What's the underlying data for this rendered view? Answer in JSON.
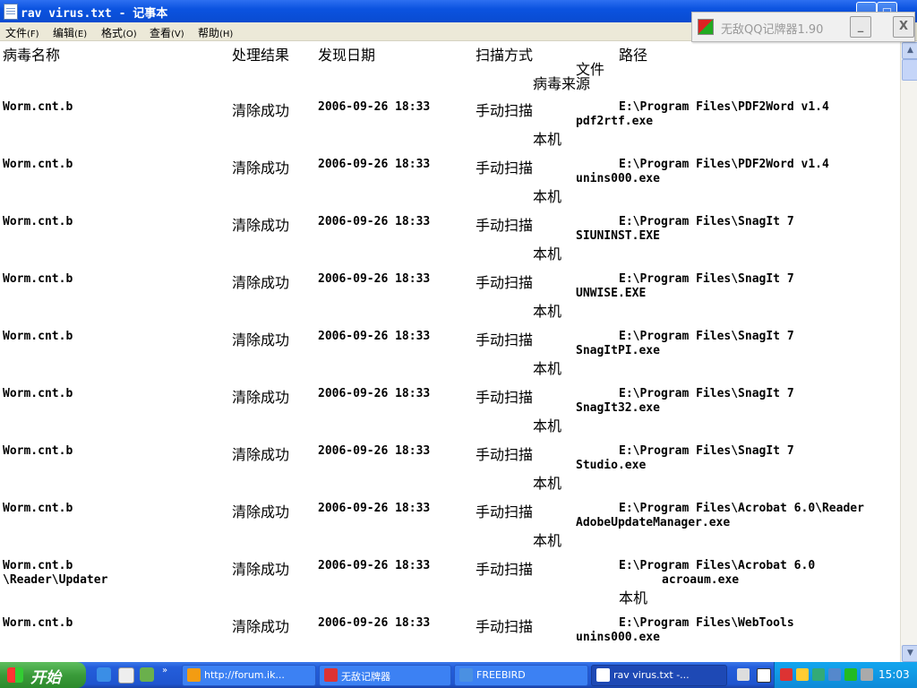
{
  "window": {
    "title": "rav virus.txt - 记事本"
  },
  "menu": [
    {
      "label": "文件",
      "accel": "(F)"
    },
    {
      "label": "编辑",
      "accel": "(E)"
    },
    {
      "label": "格式",
      "accel": "(O)"
    },
    {
      "label": "查看",
      "accel": "(V)"
    },
    {
      "label": "帮助",
      "accel": "(H)"
    }
  ],
  "qq_popup": {
    "title": "无敌QQ记牌器1.90",
    "minimize": "_",
    "close": "X"
  },
  "document": {
    "header": {
      "name": "病毒名称",
      "result": "处理结果",
      "date": "发现日期",
      "method": "扫描方式",
      "path": "路径",
      "file": "文件",
      "source": "病毒来源"
    },
    "rows": [
      {
        "name": "Worm.cnt.b",
        "result": "清除成功",
        "date": "2006-09-26 18:33",
        "method": "手动扫描",
        "path": "E:\\Program Files\\PDF2Word v1.4",
        "file": "pdf2rtf.exe",
        "source": "本机"
      },
      {
        "name": "Worm.cnt.b",
        "result": "清除成功",
        "date": "2006-09-26 18:33",
        "method": "手动扫描",
        "path": "E:\\Program Files\\PDF2Word v1.4",
        "file": "unins000.exe",
        "source": "本机"
      },
      {
        "name": "Worm.cnt.b",
        "result": "清除成功",
        "date": "2006-09-26 18:33",
        "method": "手动扫描",
        "path": "E:\\Program Files\\SnagIt 7",
        "file": "SIUNINST.EXE",
        "source": "本机"
      },
      {
        "name": "Worm.cnt.b",
        "result": "清除成功",
        "date": "2006-09-26 18:33",
        "method": "手动扫描",
        "path": "E:\\Program Files\\SnagIt 7",
        "file": "UNWISE.EXE",
        "source": "本机"
      },
      {
        "name": "Worm.cnt.b",
        "result": "清除成功",
        "date": "2006-09-26 18:33",
        "method": "手动扫描",
        "path": "E:\\Program Files\\SnagIt 7",
        "file": "SnagItPI.exe",
        "source": "本机"
      },
      {
        "name": "Worm.cnt.b",
        "result": "清除成功",
        "date": "2006-09-26 18:33",
        "method": "手动扫描",
        "path": "E:\\Program Files\\SnagIt 7",
        "file": "SnagIt32.exe",
        "source": "本机"
      },
      {
        "name": "Worm.cnt.b",
        "result": "清除成功",
        "date": "2006-09-26 18:33",
        "method": "手动扫描",
        "path": "E:\\Program Files\\SnagIt 7",
        "file": "Studio.exe",
        "source": "本机"
      },
      {
        "name": "Worm.cnt.b",
        "result": "清除成功",
        "date": "2006-09-26 18:33",
        "method": "手动扫描",
        "path": "E:\\Program Files\\Acrobat 6.0\\Reader",
        "file": "AdobeUpdateManager.exe",
        "source": "本机"
      },
      {
        "name": "Worm.cnt.b",
        "name_cont": "\\Reader\\Updater",
        "result": "清除成功",
        "date": "2006-09-26 18:33",
        "method": "手动扫描",
        "path": "E:\\Program Files\\Acrobat 6.0",
        "file": "acroaum.exe",
        "source": "本机",
        "wrapped": true
      },
      {
        "name": "Worm.cnt.b",
        "result": "清除成功",
        "date": "2006-09-26 18:33",
        "method": "手动扫描",
        "path": "E:\\Program Files\\WebTools",
        "file": "unins000.exe",
        "source": ""
      }
    ]
  },
  "taskbar": {
    "start_label": "开始",
    "tasks": [
      {
        "label": "http://forum.ik...",
        "active": false,
        "icon_color": "#f39c12"
      },
      {
        "label": "无敌记牌器",
        "active": false,
        "icon_color": "#d33"
      },
      {
        "label": "FREEBIRD",
        "active": false,
        "icon_color": "#4a90e2"
      },
      {
        "label": "rav virus.txt -...",
        "active": true,
        "icon_color": "#ffffff"
      }
    ],
    "clock": "15:03"
  }
}
